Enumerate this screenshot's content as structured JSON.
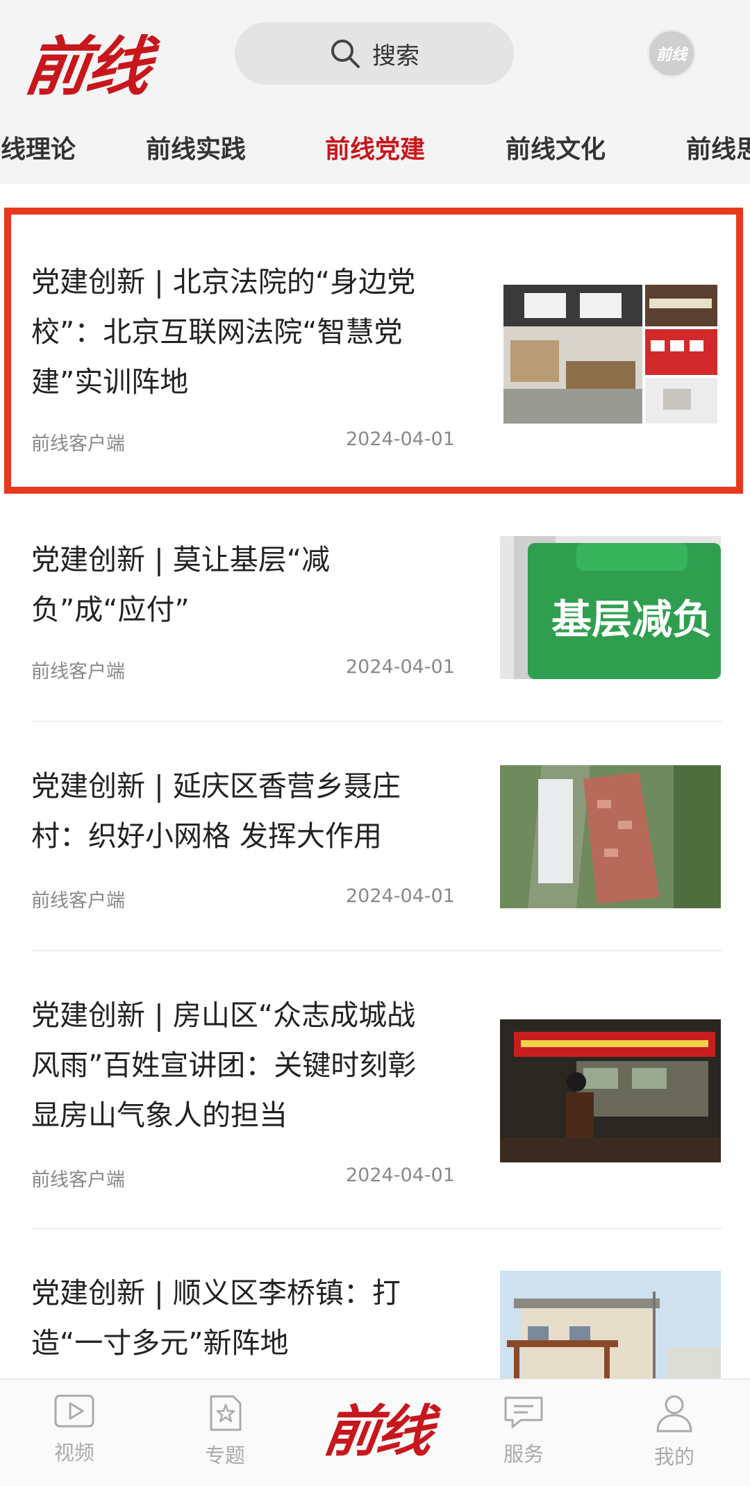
{
  "header": {
    "logo_text": "前线",
    "search_label": "搜索",
    "avatar_text": "前线"
  },
  "tabs": [
    {
      "label": "前线理论",
      "active": false
    },
    {
      "label": "前线实践",
      "active": false
    },
    {
      "label": "前线党建",
      "active": true
    },
    {
      "label": "前线文化",
      "active": false
    },
    {
      "label": "前线思",
      "active": false
    }
  ],
  "articles": [
    {
      "title": "党建创新 | 北京法院的“身边党校”：北京互联网法院“智慧党建”实训阵地",
      "source": "前线客户端",
      "date": "2024-04-01",
      "image": "office-interior-photo"
    },
    {
      "title": "党建创新 | 莫让基层“减负”成“应付”",
      "source": "前线客户端",
      "date": "2024-04-01",
      "image": "jiceng-jianfu-folder",
      "image_text": "基层减负"
    },
    {
      "title": "党建创新 | 延庆区香营乡聂庄村：织好小网格 发挥大作用",
      "source": "前线客户端",
      "date": "2024-04-01",
      "image": "aerial-village-photo"
    },
    {
      "title": "党建创新 | 房山区“众志成城战风雨”百姓宣讲团：关键时刻彰显房山气象人的担当",
      "source": "前线客户端",
      "date": "2024-04-01",
      "image": "lecture-hall-photo"
    },
    {
      "title": "党建创新 | 顺义区李桥镇：打造“一寸多元”新阵地",
      "source": "",
      "date": "",
      "image": "building-pavilion-photo"
    }
  ],
  "bottom_nav": {
    "video": {
      "label": "视频",
      "icon": "play-icon"
    },
    "topics": {
      "label": "专题",
      "icon": "star-doc-icon"
    },
    "center_logo": "前线",
    "services": {
      "label": "服务",
      "icon": "chat-icon"
    },
    "mine": {
      "label": "我的",
      "icon": "person-icon"
    }
  },
  "colors": {
    "accent": "#c8161d",
    "highlight_border": "#e8391f"
  }
}
